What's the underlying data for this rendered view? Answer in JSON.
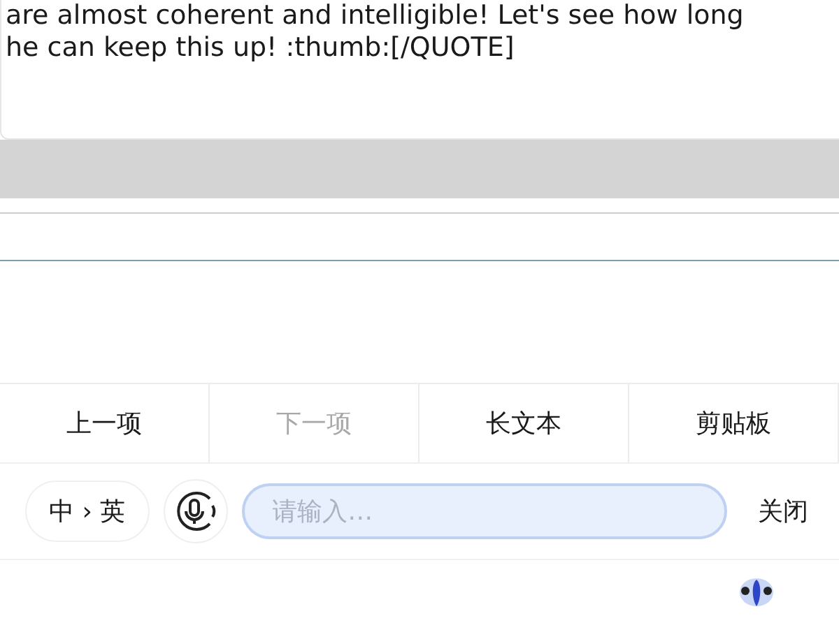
{
  "quote": {
    "lines": [
      "are almost coherent and intelligible! Let's see how long",
      "he can keep this up! :thumb:[/QUOTE]"
    ]
  },
  "toolbar": [
    {
      "label": "上一项",
      "disabled": false
    },
    {
      "label": "下一项",
      "disabled": true
    },
    {
      "label": "长文本",
      "disabled": false
    },
    {
      "label": "剪贴板",
      "disabled": false
    }
  ],
  "input_bar": {
    "language": "中 › 英",
    "placeholder": "请输入…",
    "close": "关闭"
  }
}
